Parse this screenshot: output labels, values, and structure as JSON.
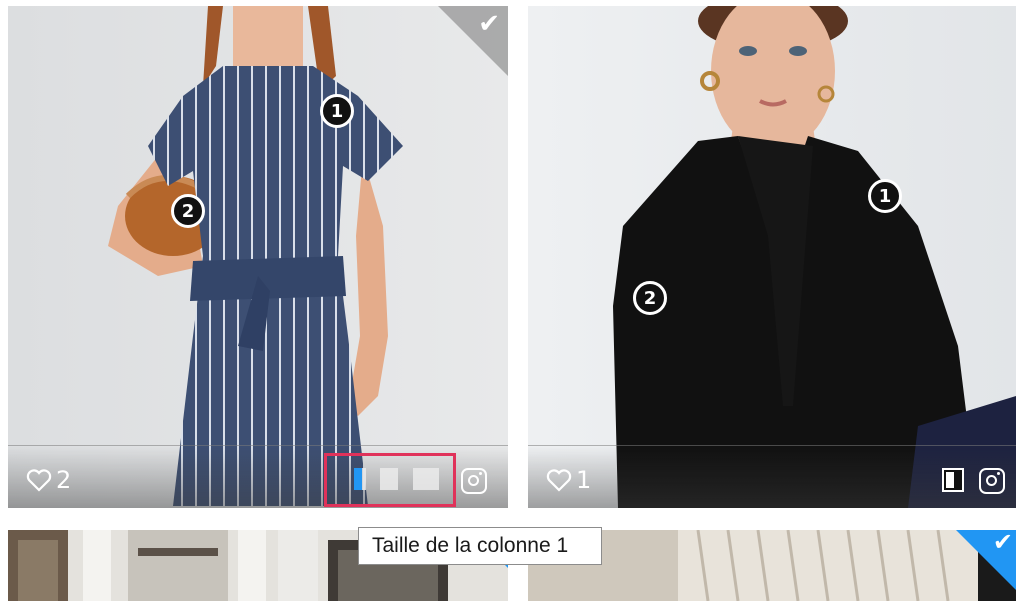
{
  "cards": [
    {
      "likes": "2",
      "markers": [
        "1",
        "2"
      ]
    },
    {
      "likes": "1",
      "markers": [
        "1",
        "2"
      ]
    }
  ],
  "tooltip": {
    "text": "Taille de la colonne 1"
  },
  "colors": {
    "accent": "#2196f3",
    "highlight": "#e0325a",
    "selectedCorner": "#969696"
  },
  "icons": [
    "heart-icon",
    "instagram-icon",
    "checkmark-icon",
    "column-size-icon"
  ]
}
